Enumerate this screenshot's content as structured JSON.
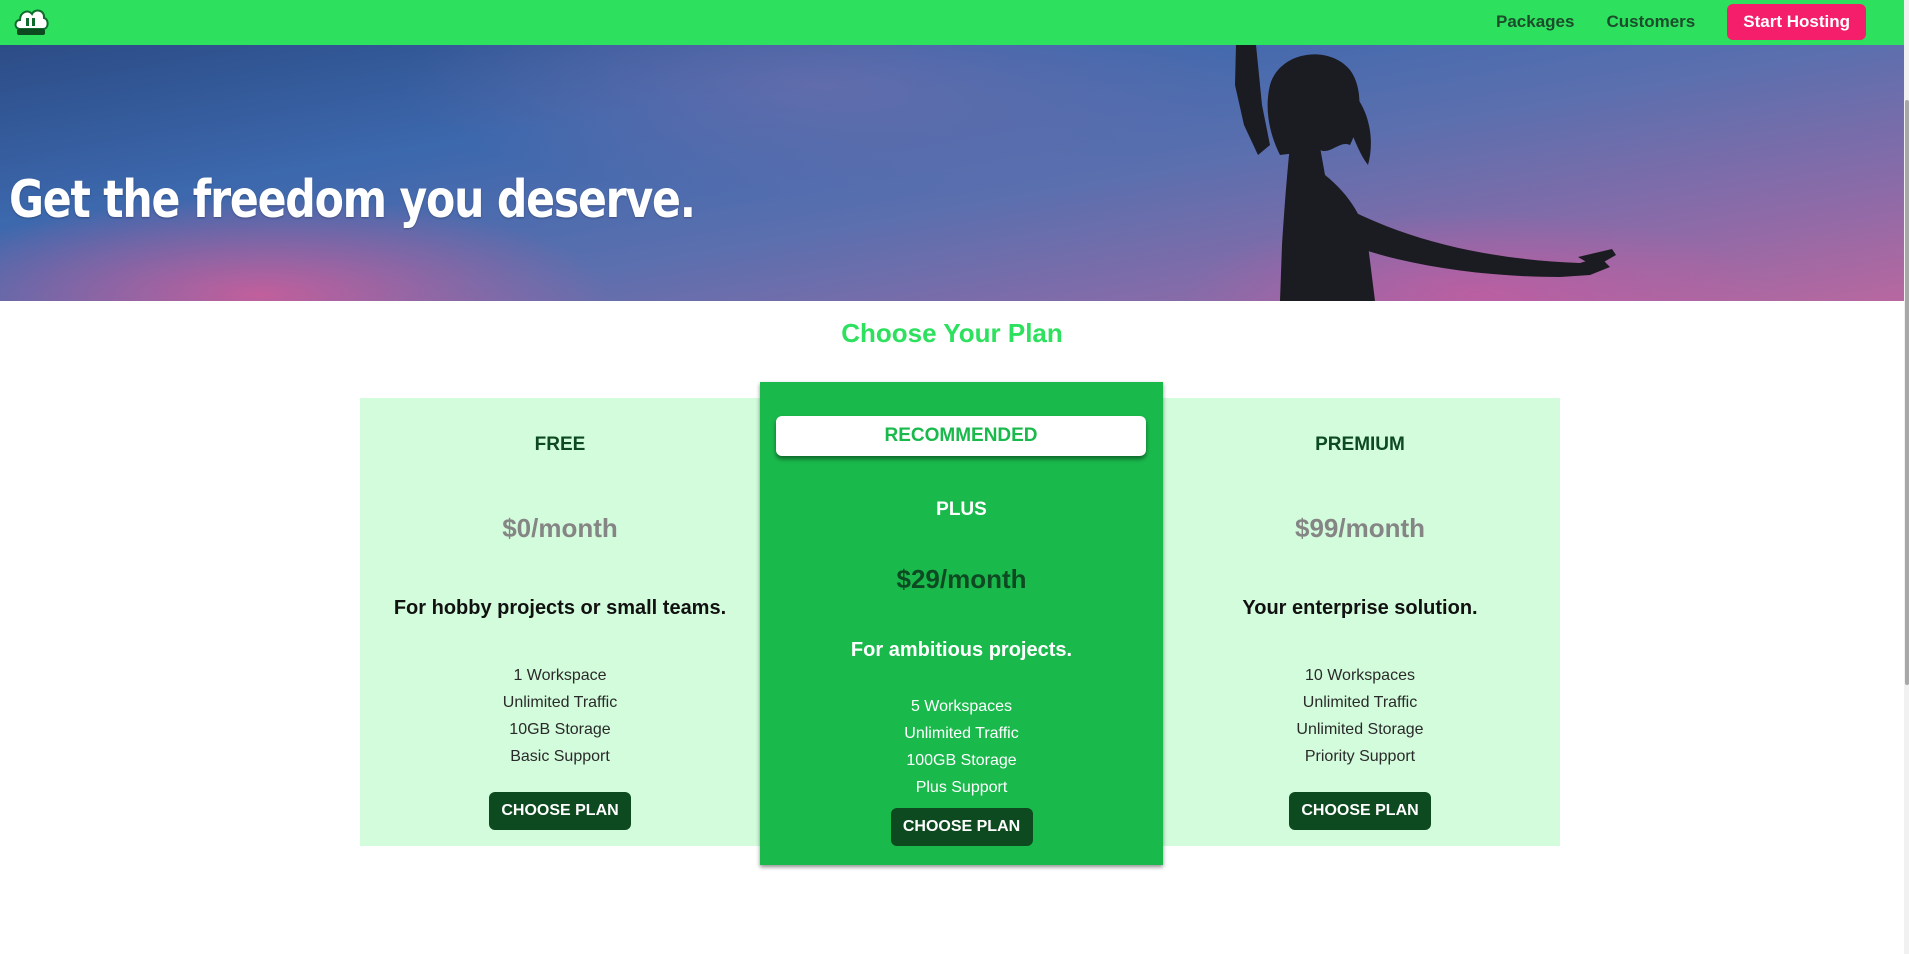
{
  "header": {
    "logo_icon": "cloud-logo-icon",
    "nav": {
      "packages": "Packages",
      "customers": "Customers",
      "cta": "Start Hosting"
    }
  },
  "hero": {
    "title": "Get the freedom you deserve."
  },
  "pricing": {
    "title": "Choose Your Plan",
    "plans": [
      {
        "name": "FREE",
        "price": "$0/month",
        "description": "For hobby projects or small teams.",
        "features": [
          "1 Workspace",
          "Unlimited Traffic",
          "10GB Storage",
          "Basic Support"
        ],
        "button": "CHOOSE PLAN"
      },
      {
        "badge": "RECOMMENDED",
        "name": "PLUS",
        "price": "$29/month",
        "description": "For ambitious projects.",
        "features": [
          "5 Workspaces",
          "Unlimited Traffic",
          "100GB Storage",
          "Plus Support"
        ],
        "button": "CHOOSE PLAN"
      },
      {
        "name": "PREMIUM",
        "price": "$99/month",
        "description": "Your enterprise solution.",
        "features": [
          "10 Workspaces",
          "Unlimited Traffic",
          "Unlimited Storage",
          "Priority Support"
        ],
        "button": "CHOOSE PLAN"
      }
    ]
  },
  "colors": {
    "header_bg": "#2de05e",
    "cta_bg": "#f51e6b",
    "plan_bg": "#d3fcdc",
    "recommended_bg": "#1ab94c",
    "button_bg": "#0e4a1f"
  }
}
